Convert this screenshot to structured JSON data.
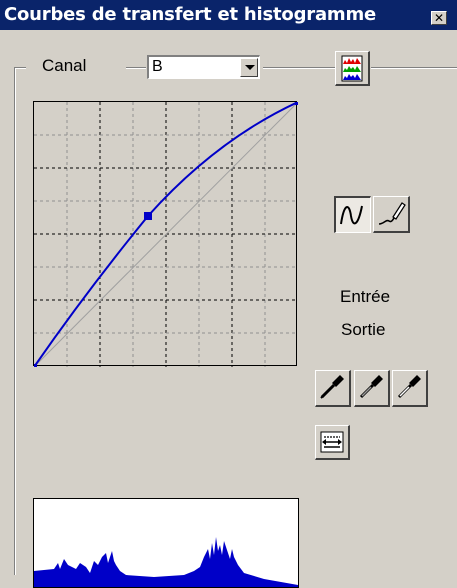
{
  "window": {
    "title": "Courbes de transfert et histogramme",
    "close_glyph": "✕"
  },
  "channel": {
    "label": "Canal",
    "selected": "B"
  },
  "icons": {
    "rgb_histogram": "rgb-histogram-icon",
    "smooth_curve": "smooth-curve-icon",
    "freehand_curve": "freehand-pencil-icon",
    "eyedropper_black": "black-point-eyedropper-icon",
    "eyedropper_gray": "gray-point-eyedropper-icon",
    "eyedropper_white": "white-point-eyedropper-icon",
    "levels": "auto-levels-icon"
  },
  "readouts": {
    "input_label": "Entrée",
    "output_label": "Sortie"
  },
  "colors": {
    "title_bar": "#0a246a",
    "curve": "#0000c8",
    "diagonal": "#a0a0a0",
    "histogram": "#0000c8",
    "dialog_bg": "#d4d0c8"
  }
}
